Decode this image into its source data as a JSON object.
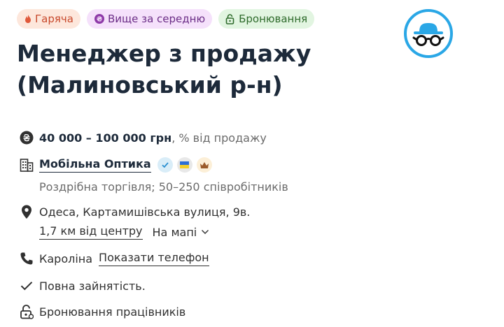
{
  "tags": {
    "hot": "Гаряча",
    "salary": "Вище за середню",
    "reserve": "Бронювання"
  },
  "logo": {
    "icon": "incognito-hat-glasses-icon",
    "color": "#2aa7e6"
  },
  "title": "Менеджер з продажу (Малиновський р-н)",
  "salary": {
    "amount": "40 000 – 100 000 грн",
    "note": ", % від продажу",
    "icon": "hryvnia-icon"
  },
  "company": {
    "name": "Мобільна Оптика",
    "description": "Роздрібна торгівля; 50–250 співробітників",
    "badges": [
      "verified-icon",
      "ukraine-flag-icon",
      "crown-icon"
    ]
  },
  "location": {
    "address": "Одеса, Картамишівська вулиця, 9в.",
    "distance": "1,7 км від центру",
    "map_label": "На мапі"
  },
  "contact": {
    "name": "Кароліна",
    "show_phone": "Показати телефон"
  },
  "employment": "Повна зайнятість.",
  "reservation": "Бронювання працівників"
}
